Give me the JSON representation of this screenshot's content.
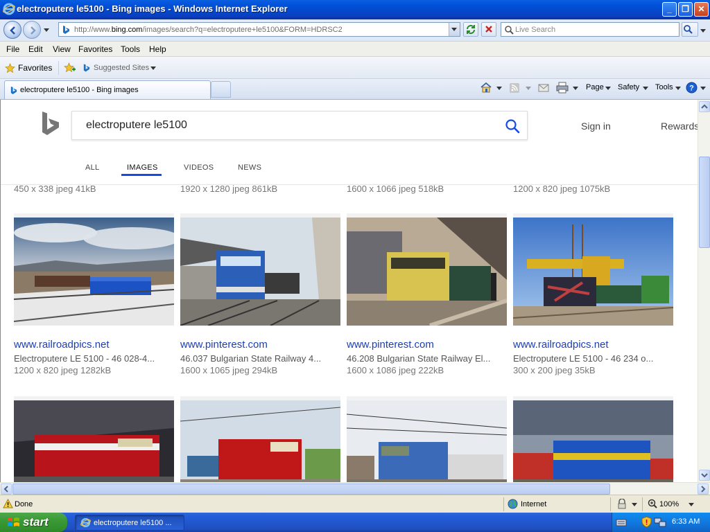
{
  "window": {
    "title": "electroputere le5100 - Bing images - Windows Internet Explorer",
    "minimize_label": "_",
    "maximize_label": "❐",
    "close_label": "✕"
  },
  "address_bar": {
    "url_prefix": "http://www.",
    "url_domain": "bing.com",
    "url_rest": "/images/search?q=electroputere+le5100&FORM=HDRSC2"
  },
  "search_box": {
    "placeholder": "Live Search"
  },
  "menu": [
    "File",
    "Edit",
    "View",
    "Favorites",
    "Tools",
    "Help"
  ],
  "favorites_bar": {
    "favorites_label": "Favorites",
    "suggested_sites_label": "Suggested Sites"
  },
  "tab": {
    "label": "electroputere le5100 - Bing images"
  },
  "command_bar": {
    "page_label": "Page",
    "safety_label": "Safety",
    "tools_label": "Tools"
  },
  "bing": {
    "query": "electroputere le5100",
    "sign_in": "Sign in",
    "rewards": "Rewards",
    "nav_tabs": [
      "ALL",
      "IMAGES",
      "VIDEOS",
      "NEWS"
    ],
    "active_tab": "IMAGES"
  },
  "top_row_meta": [
    "450 x 338 jpeg 41kB",
    "1920 x 1280 jpeg 861kB",
    "1600 x 1066 jpeg 518kB",
    "1200 x 820 jpeg 1075kB"
  ],
  "results": [
    {
      "source": "www.railroadpics.net",
      "title": "Electroputere LE 5100 - 46 028-4...",
      "size": "1200 x 820 jpeg 1282kB"
    },
    {
      "source": "www.pinterest.com",
      "title": "46.037 Bulgarian State Railway 4...",
      "size": "1600 x 1065 jpeg 294kB"
    },
    {
      "source": "www.pinterest.com",
      "title": "46.208 Bulgarian State Railway El...",
      "size": "1600 x 1086 jpeg 222kB"
    },
    {
      "source": "www.railroadpics.net",
      "title": "Electroputere LE 5100 - 46 234 o...",
      "size": "300 x 200 jpeg 35kB"
    }
  ],
  "status_bar": {
    "status": "Done",
    "zone": "Internet",
    "zoom": "100%"
  },
  "taskbar": {
    "start_label": "start",
    "task_label": "electroputere le5100 ...",
    "clock": "6:33 AM"
  },
  "colors": {
    "bing_accent": "#174ae4",
    "link": "#1b3fb3",
    "xp_blue": "#245edb",
    "start_green": "#3a9a35"
  }
}
